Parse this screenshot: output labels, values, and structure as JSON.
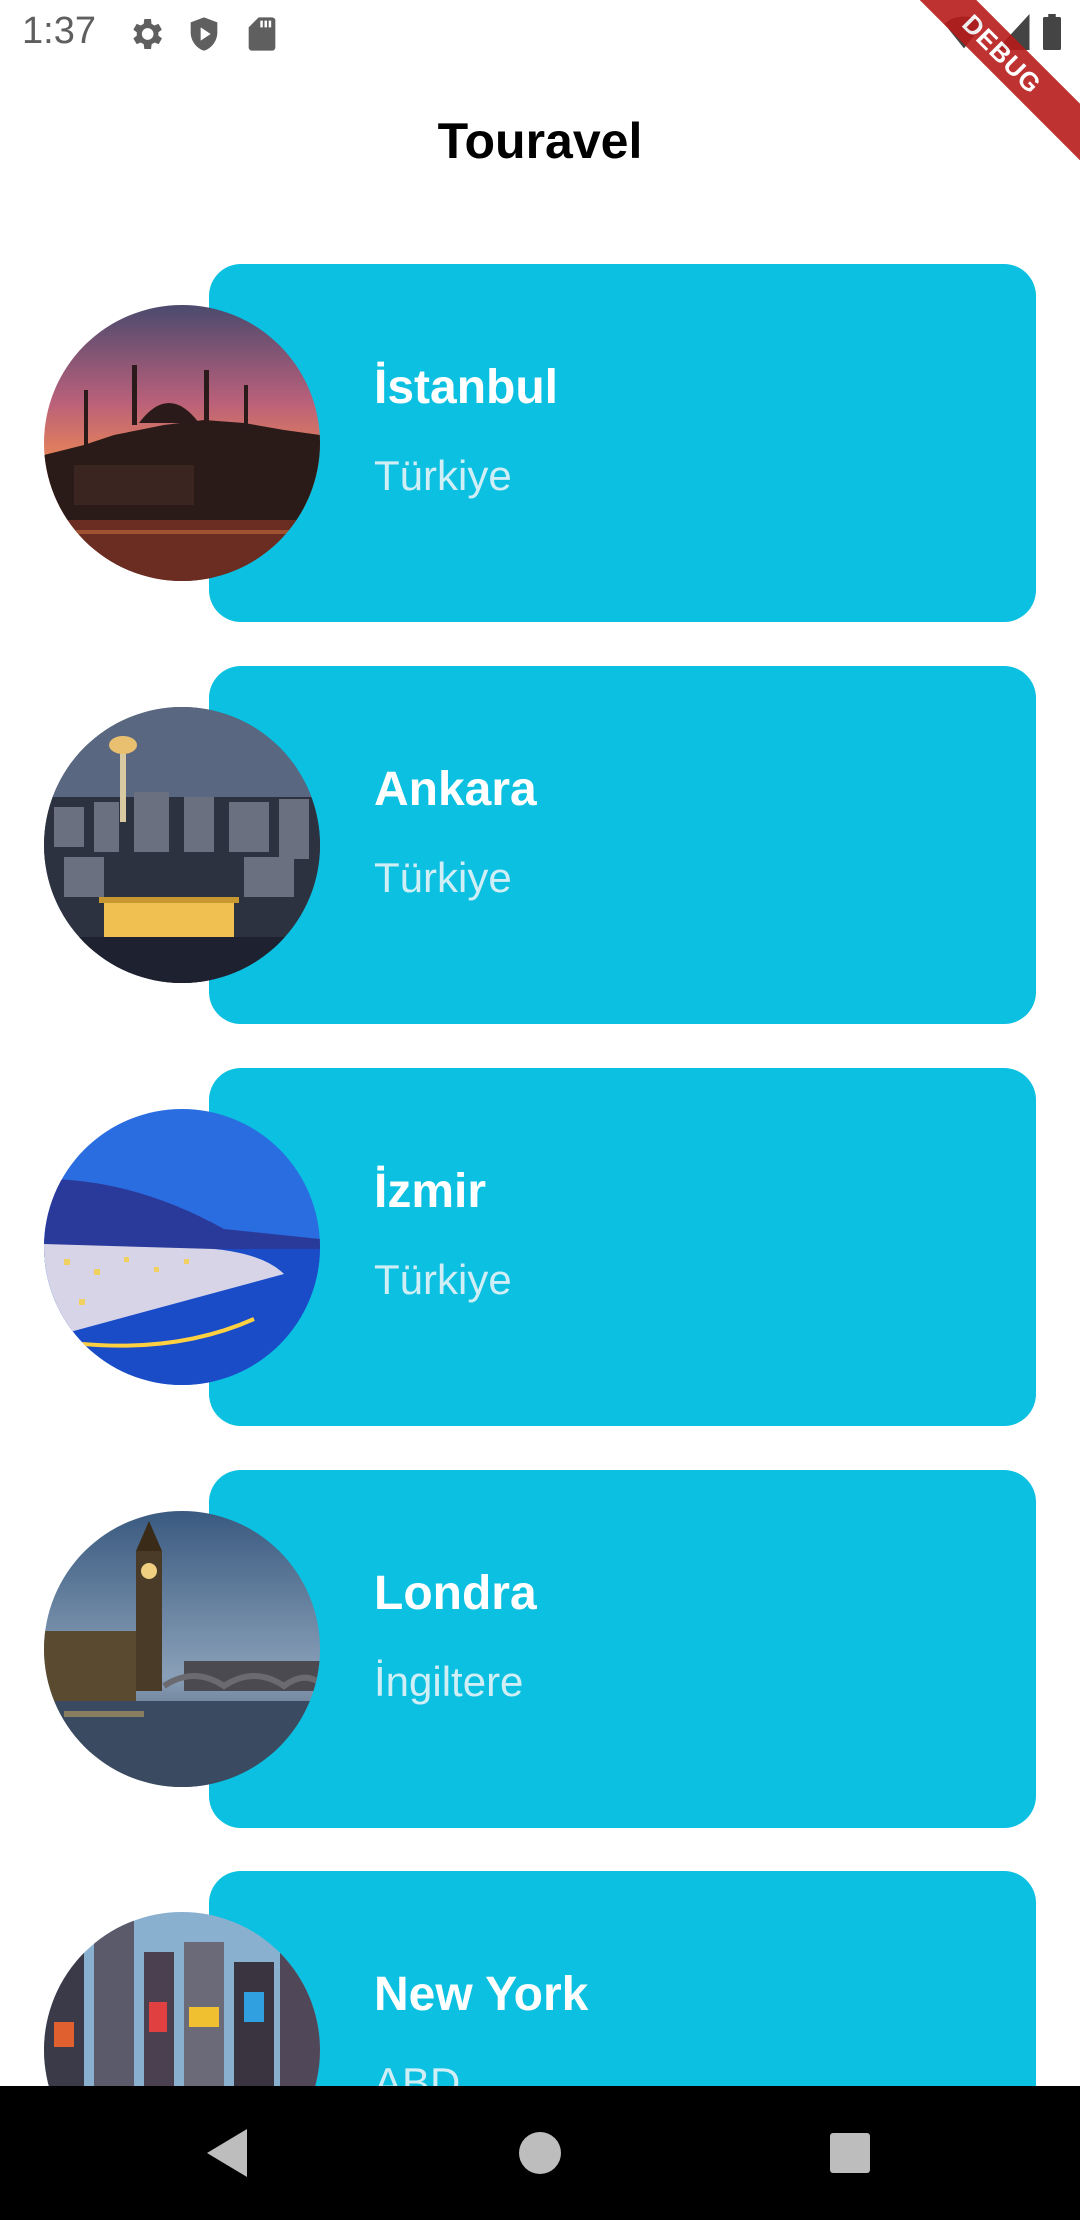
{
  "status_bar": {
    "time": "1:37",
    "left_icons": [
      "gear-icon",
      "shield-play-icon",
      "sd-card-icon"
    ],
    "right_icons": [
      "wifi-icon",
      "signal-icon",
      "battery-icon"
    ]
  },
  "debug_banner": "DEBUG",
  "app_bar": {
    "title": "Touravel"
  },
  "destinations": [
    {
      "city": "İstanbul",
      "country": "Türkiye"
    },
    {
      "city": "Ankara",
      "country": "Türkiye"
    },
    {
      "city": "İzmir",
      "country": "Türkiye"
    },
    {
      "city": "Londra",
      "country": "İngiltere"
    },
    {
      "city": "New York",
      "country": "ABD"
    }
  ],
  "colors": {
    "card": "#0bc0e0",
    "city_text": "#ffffff",
    "country_text": "#cfeef5",
    "nav_bar": "#000000"
  },
  "nav_bar": {
    "buttons": [
      "back-icon",
      "home-icon",
      "recents-icon"
    ]
  }
}
